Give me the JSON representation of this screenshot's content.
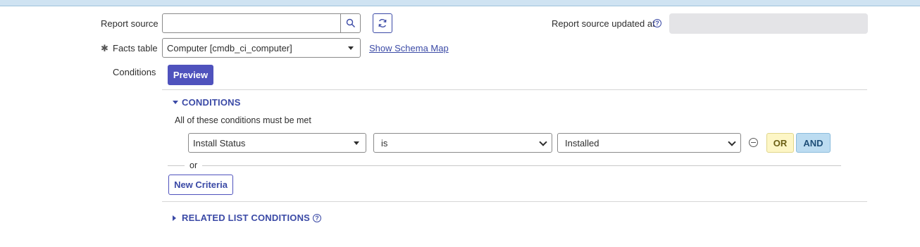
{
  "form": {
    "report_source_label": "Report source",
    "report_source_value": "",
    "updated_label": "Report source updated at",
    "updated_value": "",
    "facts_required_mark": "✱",
    "facts_table_label": "Facts table",
    "facts_table_value": "Computer [cmdb_ci_computer]",
    "schema_map_link": "Show Schema Map",
    "conditions_label": "Conditions",
    "preview_button": "Preview"
  },
  "conditions": {
    "title": "CONDITIONS",
    "description": "All of these conditions must be met",
    "row": {
      "field": "Install Status",
      "operator": "is",
      "value": "Installed"
    },
    "or_button": "OR",
    "and_button": "AND",
    "or_divider": "or",
    "new_criteria_button": "New Criteria"
  },
  "related": {
    "title": "RELATED LIST CONDITIONS"
  },
  "icons": {
    "search": "search-icon",
    "refresh": "refresh-icon",
    "help": "help-icon",
    "remove": "remove-condition-icon"
  }
}
